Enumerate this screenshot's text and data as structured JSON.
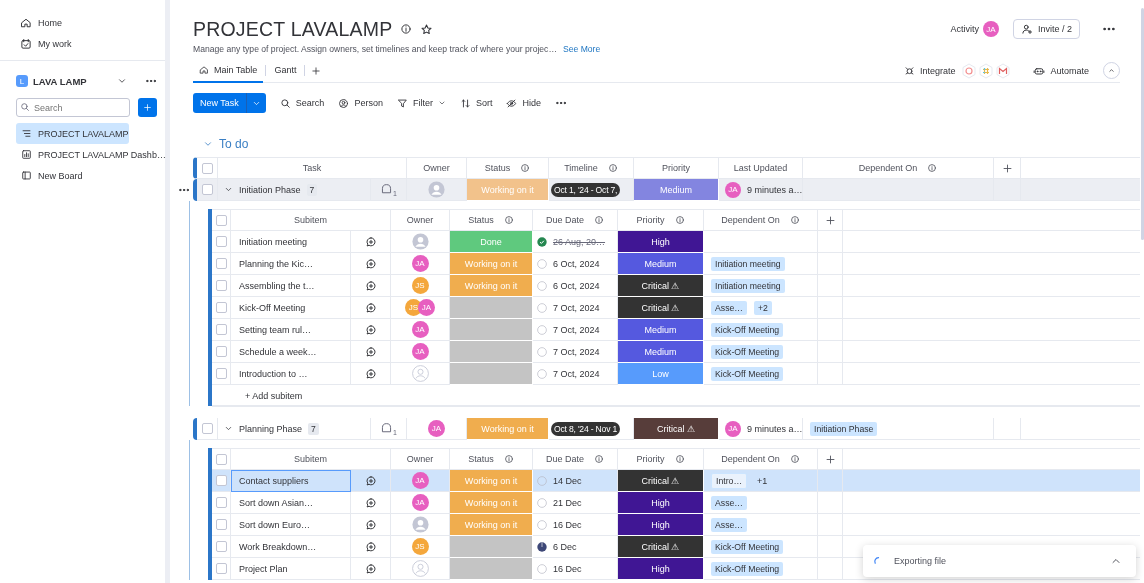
{
  "sidebar": {
    "nav": [
      {
        "label": "Home"
      },
      {
        "label": "My work"
      }
    ],
    "workspace": {
      "initial": "L",
      "name": "LAVA LAMP"
    },
    "search": {
      "placeholder": "Search"
    },
    "boards": [
      {
        "label": "PROJECT LAVALAMP",
        "kind": "board",
        "selected": true
      },
      {
        "label": "PROJECT LAVALAMP Dashb…",
        "kind": "dashboard",
        "selected": false
      },
      {
        "label": "New Board",
        "kind": "doc",
        "selected": false
      }
    ]
  },
  "board": {
    "title": "PROJECT LAVALAMP",
    "description": "Manage any type of project. Assign owners, set timelines and keep track of where your projec…",
    "see_more": "See More",
    "activity": {
      "label": "Activity",
      "avatar": {
        "kind": "initials",
        "initials": "JA",
        "color": "#e75fc0"
      }
    },
    "invite": "Invite / 2",
    "tabs": [
      {
        "label": "Main Table",
        "selected": true
      },
      {
        "label": "Gantt",
        "selected": false
      }
    ],
    "integrate": "Integrate",
    "automate": "Automate"
  },
  "toolbar": {
    "new_task": "New Task",
    "actions": [
      {
        "label": "Search",
        "dropdown": false
      },
      {
        "label": "Person",
        "dropdown": false
      },
      {
        "label": "Filter",
        "dropdown": true
      },
      {
        "label": "Sort",
        "dropdown": false
      },
      {
        "label": "Hide",
        "dropdown": false
      }
    ]
  },
  "group": {
    "title": "To do",
    "checked": false,
    "columns": [
      {
        "label": "Task",
        "info": false
      },
      {
        "label": "Owner",
        "info": false
      },
      {
        "label": "Status",
        "info": true
      },
      {
        "label": "Timeline",
        "info": true
      },
      {
        "label": "Priority",
        "info": false
      },
      {
        "label": "Last Updated",
        "info": false
      },
      {
        "label": "Dependent On",
        "info": true
      }
    ],
    "items": [
      {
        "name": "Initiation Phase",
        "count": "7",
        "updates": "1",
        "hovered": true,
        "owners": [
          {
            "kind": "placeholder"
          }
        ],
        "status": {
          "label": "Working on it",
          "color": "#f2c28b"
        },
        "timeline": "Oct 1, '24 - Oct 7,",
        "priority": {
          "label": "Medium",
          "color": "#8385e0"
        },
        "last_updated": {
          "avatar": {
            "kind": "initials",
            "initials": "JA",
            "color": "#e75fc0"
          },
          "text": "9 minutes a…"
        },
        "checked": false,
        "subitems": {
          "checked": false,
          "columns": [
            {
              "label": "Subitem",
              "info": false
            },
            {
              "label": "Owner",
              "info": false
            },
            {
              "label": "Status",
              "info": true
            },
            {
              "label": "Due Date",
              "info": true
            },
            {
              "label": "Priority",
              "info": true
            },
            {
              "label": "Dependent On",
              "info": true
            }
          ],
          "add_label": "+ Add subitem",
          "rows": [
            {
              "name": "Initiation meeting",
              "selected": false,
              "owners": [
                {
                  "kind": "placeholder"
                }
              ],
              "status": {
                "label": "Done",
                "color": "#5fc97e"
              },
              "due": {
                "text": "26 Aug, 20…",
                "kind": "done"
              },
              "priority": {
                "label": "High",
                "color": "#401694"
              }
            },
            {
              "name": "Planning the Kic…",
              "selected": false,
              "owners": [
                {
                  "kind": "initials",
                  "initials": "JA",
                  "color": "#e75fc0"
                }
              ],
              "status": {
                "label": "Working on it",
                "color": "#f0ad4e"
              },
              "due": {
                "text": "6 Oct, 2024",
                "kind": "open"
              },
              "priority": {
                "label": "Medium",
                "color": "#5559df"
              },
              "dependent_on": [
                {
                  "label": "Initiation meeting",
                  "kind": "tag"
                }
              ]
            },
            {
              "name": "Assembling the t…",
              "selected": false,
              "owners": [
                {
                  "kind": "initials",
                  "initials": "JS",
                  "color": "#f4a73c"
                }
              ],
              "status": {
                "label": "Working on it",
                "color": "#f0ad4e"
              },
              "due": {
                "text": "6 Oct, 2024",
                "kind": "open"
              },
              "priority": {
                "label": "Critical ⚠",
                "color": "#333333"
              },
              "dependent_on": [
                {
                  "label": "Initiation meeting",
                  "kind": "tag"
                }
              ]
            },
            {
              "name": "Kick-Off Meeting",
              "selected": false,
              "owners": [
                {
                  "kind": "initials",
                  "initials": "JS",
                  "color": "#f4a73c"
                },
                {
                  "kind": "initials",
                  "initials": "JA",
                  "color": "#e75fc0"
                }
              ],
              "status": {
                "color": "#c4c4c4"
              },
              "due": {
                "text": "7 Oct, 2024",
                "kind": "open"
              },
              "priority": {
                "label": "Critical ⚠",
                "color": "#333333"
              },
              "dependent_on": [
                {
                  "label": "Asse…",
                  "kind": "tag"
                },
                {
                  "label": "+2",
                  "kind": "tag"
                }
              ]
            },
            {
              "name": "Setting team rul…",
              "selected": false,
              "owners": [
                {
                  "kind": "initials",
                  "initials": "JA",
                  "color": "#e75fc0"
                }
              ],
              "status": {
                "color": "#c4c4c4"
              },
              "due": {
                "text": "7 Oct, 2024",
                "kind": "open"
              },
              "priority": {
                "label": "Medium",
                "color": "#5559df"
              },
              "dependent_on": [
                {
                  "label": "Kick-Off Meeting",
                  "kind": "tag"
                }
              ]
            },
            {
              "name": "Schedule a week…",
              "selected": false,
              "owners": [
                {
                  "kind": "initials",
                  "initials": "JA",
                  "color": "#e75fc0"
                }
              ],
              "status": {
                "color": "#c4c4c4"
              },
              "due": {
                "text": "7 Oct, 2024",
                "kind": "open"
              },
              "priority": {
                "label": "Medium",
                "color": "#5559df"
              },
              "dependent_on": [
                {
                  "label": "Kick-Off Meeting",
                  "kind": "tag"
                }
              ]
            },
            {
              "name": "Introduction to …",
              "selected": false,
              "owners": [
                {
                  "kind": "empty"
                }
              ],
              "status": {
                "color": "#c4c4c4"
              },
              "due": {
                "text": "7 Oct, 2024",
                "kind": "open"
              },
              "priority": {
                "label": "Low",
                "color": "#579bfc"
              },
              "dependent_on": [
                {
                  "label": "Kick-Off Meeting",
                  "kind": "tag"
                }
              ]
            }
          ]
        }
      },
      {
        "name": "Planning Phase",
        "count": "7",
        "updates": "1",
        "hovered": false,
        "owners": [
          {
            "kind": "initials",
            "initials": "JA",
            "color": "#e75fc0"
          }
        ],
        "status": {
          "label": "Working on it",
          "color": "#f0ad4e"
        },
        "timeline": "Oct 8, '24 - Nov 1",
        "priority": {
          "label": "Critical ⚠",
          "color": "#573d3a"
        },
        "last_updated": {
          "avatar": {
            "kind": "initials",
            "initials": "JA",
            "color": "#e75fc0"
          },
          "text": "9 minutes a…"
        },
        "checked": false,
        "dependent_on": [
          {
            "label": "Initiation Phase",
            "kind": "tag"
          }
        ],
        "subitems": {
          "checked": false,
          "columns": [
            {
              "label": "Subitem",
              "info": false
            },
            {
              "label": "Owner",
              "info": false
            },
            {
              "label": "Status",
              "info": true
            },
            {
              "label": "Due Date",
              "info": true
            },
            {
              "label": "Priority",
              "info": true
            },
            {
              "label": "Dependent On",
              "info": true
            }
          ],
          "rows": [
            {
              "name": "Contact suppliers",
              "selected": true,
              "owners": [
                {
                  "kind": "initials",
                  "initials": "JA",
                  "color": "#e75fc0"
                }
              ],
              "status": {
                "label": "Working on it",
                "color": "#f0ad4e"
              },
              "due": {
                "text": "14 Dec",
                "kind": "open"
              },
              "priority": {
                "label": "Critical ⚠",
                "color": "#333333"
              },
              "dependent_on": [
                {
                  "label": "Intro…",
                  "kind": "tag"
                },
                {
                  "label": "+1",
                  "kind": "count"
                }
              ]
            },
            {
              "name": "Sort down Asian…",
              "selected": false,
              "owners": [
                {
                  "kind": "initials",
                  "initials": "JA",
                  "color": "#e75fc0"
                }
              ],
              "status": {
                "label": "Working on it",
                "color": "#f0ad4e"
              },
              "due": {
                "text": "21 Dec",
                "kind": "open"
              },
              "priority": {
                "label": "High",
                "color": "#401694"
              },
              "dependent_on": [
                {
                  "label": "Asse…",
                  "kind": "tag"
                }
              ]
            },
            {
              "name": "Sort down Euro…",
              "selected": false,
              "owners": [
                {
                  "kind": "placeholder"
                }
              ],
              "status": {
                "label": "Working on it",
                "color": "#f0ad4e"
              },
              "due": {
                "text": "16 Dec",
                "kind": "open"
              },
              "priority": {
                "label": "High",
                "color": "#401694"
              },
              "dependent_on": [
                {
                  "label": "Asse…",
                  "kind": "tag"
                }
              ]
            },
            {
              "name": "Work Breakdown…",
              "selected": false,
              "owners": [
                {
                  "kind": "initials",
                  "initials": "JS",
                  "color": "#f4a73c"
                }
              ],
              "status": {
                "color": "#c4c4c4"
              },
              "due": {
                "text": "6 Dec",
                "kind": "partial"
              },
              "priority": {
                "label": "Critical ⚠",
                "color": "#333333"
              },
              "dependent_on": [
                {
                  "label": "Kick-Off Meeting",
                  "kind": "tag"
                }
              ]
            },
            {
              "name": "Project Plan",
              "selected": false,
              "owners": [
                {
                  "kind": "empty"
                }
              ],
              "status": {
                "color": "#c4c4c4"
              },
              "due": {
                "text": "16 Dec",
                "kind": "open"
              },
              "priority": {
                "label": "High",
                "color": "#401694"
              },
              "dependent_on": [
                {
                  "label": "Kick-Off Meeting",
                  "kind": "tag"
                }
              ]
            }
          ]
        }
      }
    ]
  },
  "toast": {
    "text": "Exporting file"
  }
}
